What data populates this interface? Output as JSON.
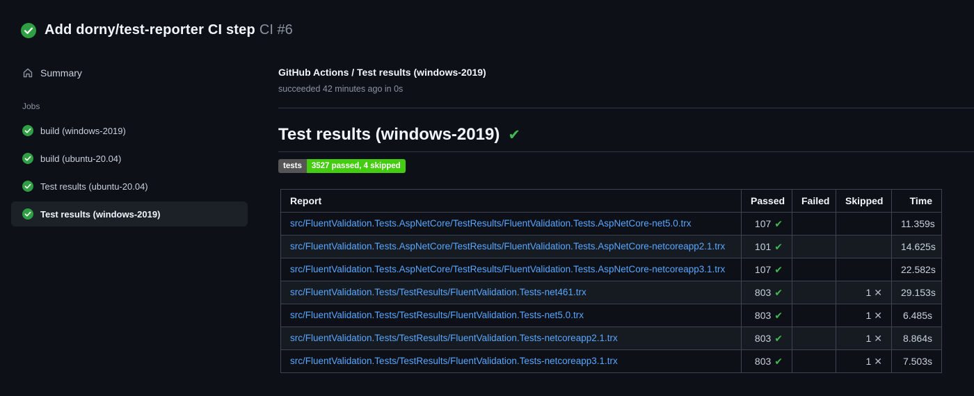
{
  "run_header": {
    "title": "Add dorny/test-reporter CI step",
    "run_number": "CI #6"
  },
  "sidebar": {
    "summary_label": "Summary",
    "jobs_heading": "Jobs",
    "jobs": [
      {
        "label": "build (windows-2019)",
        "status": "success",
        "selected": false
      },
      {
        "label": "build (ubuntu-20.04)",
        "status": "success",
        "selected": false
      },
      {
        "label": "Test results (ubuntu-20.04)",
        "status": "success",
        "selected": false
      },
      {
        "label": "Test results (windows-2019)",
        "status": "success",
        "selected": true
      }
    ]
  },
  "job_panel": {
    "title": "GitHub Actions / Test results (windows-2019)",
    "status_line": "succeeded 42 minutes ago in 0s",
    "heading": "Test results (windows-2019)",
    "heading_check": "✔"
  },
  "badge": {
    "label": "tests",
    "value": "3527 passed, 4 skipped",
    "label_bg": "#555555",
    "value_bg": "#44cc11"
  },
  "results_table": {
    "columns": [
      "Report",
      "Passed",
      "Failed",
      "Skipped",
      "Time"
    ],
    "rows": [
      {
        "report": "src/FluentValidation.Tests.AspNetCore/TestResults/FluentValidation.Tests.AspNetCore-net5.0.trx",
        "passed": "107",
        "failed": "",
        "skipped": "",
        "time": "11.359s"
      },
      {
        "report": "src/FluentValidation.Tests.AspNetCore/TestResults/FluentValidation.Tests.AspNetCore-netcoreapp2.1.trx",
        "passed": "101",
        "failed": "",
        "skipped": "",
        "time": "14.625s"
      },
      {
        "report": "src/FluentValidation.Tests.AspNetCore/TestResults/FluentValidation.Tests.AspNetCore-netcoreapp3.1.trx",
        "passed": "107",
        "failed": "",
        "skipped": "",
        "time": "22.582s"
      },
      {
        "report": "src/FluentValidation.Tests/TestResults/FluentValidation.Tests-net461.trx",
        "passed": "803",
        "failed": "",
        "skipped": "1",
        "time": "29.153s"
      },
      {
        "report": "src/FluentValidation.Tests/TestResults/FluentValidation.Tests-net5.0.trx",
        "passed": "803",
        "failed": "",
        "skipped": "1",
        "time": "6.485s"
      },
      {
        "report": "src/FluentValidation.Tests/TestResults/FluentValidation.Tests-netcoreapp2.1.trx",
        "passed": "803",
        "failed": "",
        "skipped": "1",
        "time": "8.864s"
      },
      {
        "report": "src/FluentValidation.Tests/TestResults/FluentValidation.Tests-netcoreapp3.1.trx",
        "passed": "803",
        "failed": "",
        "skipped": "1",
        "time": "7.503s"
      }
    ],
    "passed_icon": "✔",
    "skipped_icon": "✕"
  },
  "colors": {
    "background": "#0d1117",
    "success_green": "#2ea043",
    "check_green": "#3fb950",
    "link_blue": "#58a6ff",
    "row_alt": "#161b22"
  }
}
